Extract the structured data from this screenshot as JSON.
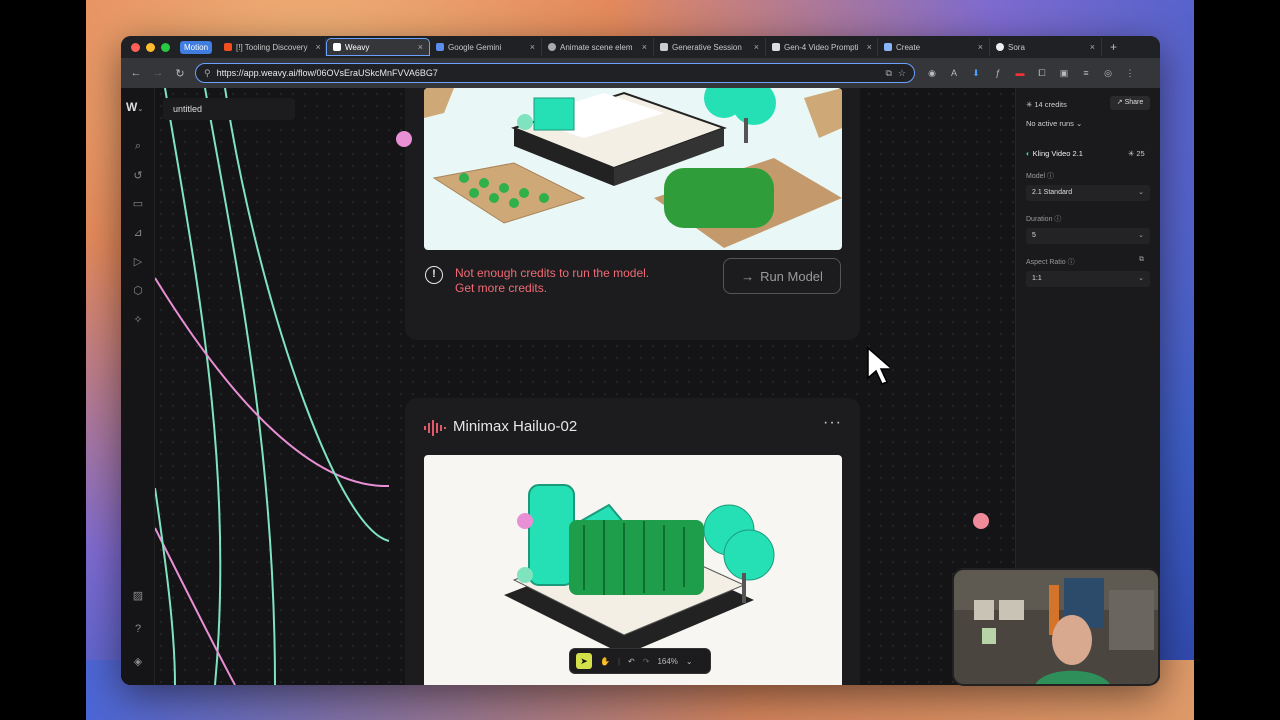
{
  "browser": {
    "tabs": [
      {
        "label": "Motion",
        "badge": true
      },
      {
        "label": "[!] Tooling Discovery"
      },
      {
        "label": "Weavy",
        "active": true
      },
      {
        "label": "Google Gemini"
      },
      {
        "label": "Animate scene elem"
      },
      {
        "label": "Generative Session"
      },
      {
        "label": "Gen-4 Video Prompti"
      },
      {
        "label": "Create"
      },
      {
        "label": "Sora"
      }
    ],
    "url": "https://app.weavy.ai/flow/06OVsEraUSkcMnFVVA6BG7"
  },
  "app": {
    "file_name": "untitled",
    "node1": {
      "warning_line1": "Not enough credits to run the model.",
      "warning_line2": "Get more credits.",
      "run_button": "Run Model"
    },
    "node2": {
      "title": "Minimax Hailuo-02",
      "menu": "···"
    },
    "toolbar": {
      "zoom": "164%"
    }
  },
  "right_panel": {
    "credits": "14 credits",
    "share": "Share",
    "runs": "No active runs",
    "model_name": "Kling Video 2.1",
    "model_cost": "25",
    "model_label": "Model",
    "model_value": "2.1 Standard",
    "duration_label": "Duration",
    "duration_value": "5",
    "aspect_label": "Aspect Ratio",
    "aspect_value": "1:1"
  },
  "colors": {
    "accent_pink": "#e98fd6",
    "accent_green": "#7fe3c0",
    "warning_red": "#f06a73",
    "tile_green": "#25e0b4"
  }
}
